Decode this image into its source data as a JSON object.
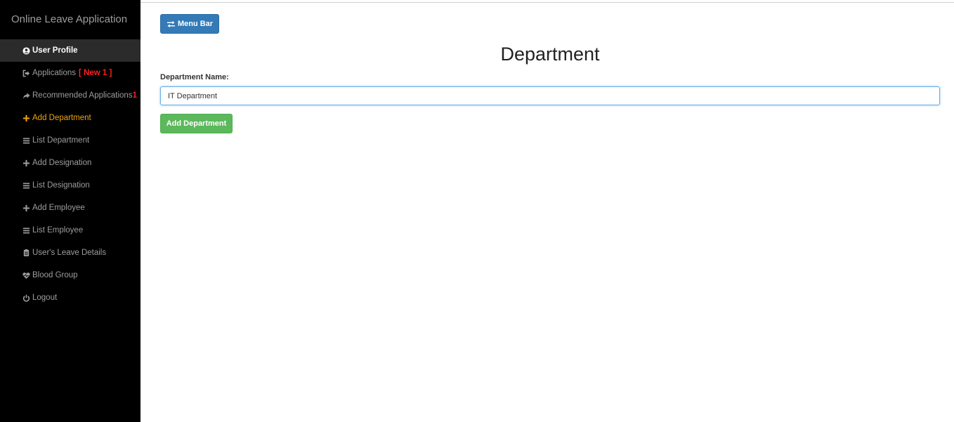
{
  "app": {
    "title": "Online Leave Application"
  },
  "sidebar": {
    "items": [
      {
        "label": "User Profile",
        "icon": "user-circle-icon",
        "state": "active"
      },
      {
        "label": "Applications",
        "badge": "[ New 1 ]",
        "icon": "sign-out-icon"
      },
      {
        "label": "Recommended Applications",
        "badge": "1",
        "icon": "share-arrow-icon"
      },
      {
        "label": "Add Department",
        "icon": "plus-icon",
        "state": "current"
      },
      {
        "label": "List Department",
        "icon": "list-icon"
      },
      {
        "label": "Add Designation",
        "icon": "plus-icon"
      },
      {
        "label": "List Designation",
        "icon": "list-icon"
      },
      {
        "label": "Add Employee",
        "icon": "plus-icon"
      },
      {
        "label": "List Employee",
        "icon": "list-icon"
      },
      {
        "label": "User's Leave Details",
        "icon": "clipboard-icon"
      },
      {
        "label": "Blood Group",
        "icon": "heartbeat-icon"
      },
      {
        "label": "Logout",
        "icon": "power-icon"
      }
    ]
  },
  "toolbar": {
    "menu_label": "Menu Bar",
    "menu_icon": "swap-arrows-icon"
  },
  "main": {
    "title": "Department",
    "form": {
      "department_label": "Department Name:",
      "department_value": "IT Department",
      "submit_label": "Add Department"
    }
  },
  "colors": {
    "sidebar_bg": "#000000",
    "active_bg": "#2b2b2b",
    "current_item": "#f0a30a",
    "badge": "#ff1f1f",
    "primary_button": "#337ab7",
    "success_button": "#5cb85c",
    "input_focus": "#66afe9"
  }
}
